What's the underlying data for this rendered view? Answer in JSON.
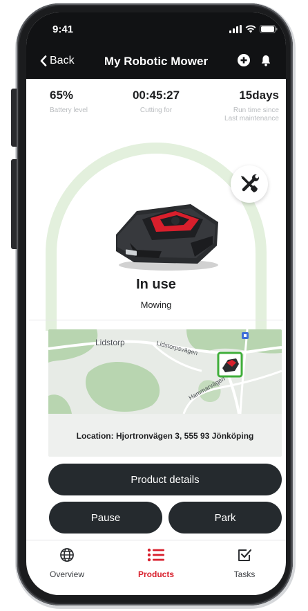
{
  "status_bar": {
    "time": "9:41"
  },
  "nav": {
    "back_label": "Back",
    "title": "My Robotic Mower"
  },
  "stats": [
    {
      "value": "65%",
      "label": "Battery level"
    },
    {
      "value": "00:45:27",
      "label": "Cutting for"
    },
    {
      "value": "15days",
      "label_line1": "Run time since",
      "label_line2": "Last maintenance"
    }
  ],
  "mower": {
    "state": "In use",
    "activity": "Mowing"
  },
  "map": {
    "place_label": "Lidstorp",
    "road_label_1": "Lidstorpsvägen",
    "road_label_2": "Hammarvägen",
    "location_text": "Location: Hjortronvägen 3, 555 93 Jönköping"
  },
  "actions": {
    "details": "Product details",
    "pause": "Pause",
    "park": "Park"
  },
  "tabs": [
    {
      "label": "Overview",
      "icon": "globe-icon"
    },
    {
      "label": "Products",
      "icon": "list-icon",
      "active": true
    },
    {
      "label": "Tasks",
      "icon": "checkbox-icon"
    }
  ],
  "colors": {
    "header_bg": "#111214",
    "accent_red": "#d81f2c",
    "button_dark": "#252a2e",
    "gauge_green": "#e3f0dd",
    "marker_green": "#3fae3a"
  }
}
